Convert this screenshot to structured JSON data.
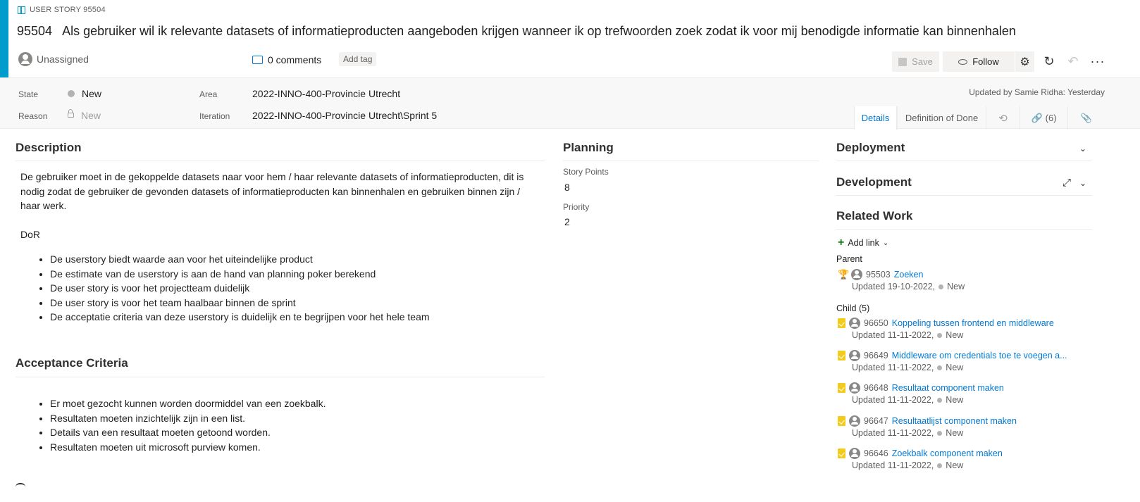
{
  "header": {
    "type_label": "USER STORY 95504",
    "id": "95504",
    "title": "Als gebruiker wil ik relevante datasets of informatieproducten aangeboden krijgen wanneer ik op trefwoorden zoek zodat ik voor mij benodigde informatie kan binnenhalen",
    "assignee": "Unassigned",
    "comments": "0 comments",
    "add_tag": "Add tag",
    "accent_color": "#009ccc"
  },
  "toolbar": {
    "save": "Save",
    "follow": "Follow",
    "settings_icon": "gear-icon",
    "refresh_icon": "refresh-icon",
    "undo_icon": "undo-icon",
    "more_icon": "more-icon"
  },
  "fields": {
    "state_label": "State",
    "state_value": "New",
    "reason_label": "Reason",
    "reason_value": "New",
    "area_label": "Area",
    "area_value": "2022-INNO-400-Provincie Utrecht",
    "iteration_label": "Iteration",
    "iteration_value": "2022-INNO-400-Provincie Utrecht\\Sprint 5",
    "updated_by": "Updated by Samie Ridha: Yesterday"
  },
  "tabs": {
    "details": "Details",
    "dod": "Definition of Done",
    "history_icon": "history-icon",
    "links": "(6)",
    "attachment_icon": "paperclip-icon"
  },
  "description": {
    "title": "Description",
    "paragraph": "De gebruiker moet in de gekoppelde datasets naar voor hem / haar relevante datasets of informatieproducten, dit is nodig zodat de gebruiker de gevonden datasets of informatieproducten kan binnenhalen en gebruiken binnen zijn / haar werk.",
    "dor": "DoR",
    "bullets": [
      "De userstory biedt waarde aan voor het uiteindelijke product",
      "De estimate van de userstory is aan de hand van planning poker berekend",
      "De user story is voor het projectteam duidelijk",
      "De user story is voor het team haalbaar binnen de sprint",
      "De acceptatie criteria van deze userstory is duidelijk en te begrijpen voor het hele team"
    ]
  },
  "acceptance": {
    "title": "Acceptance Criteria",
    "bullets": [
      "Er moet gezocht kunnen worden doormiddel van een zoekbalk.",
      "Resultaten moeten inzichtelijk zijn in een list.",
      "Details van een resultaat moeten getoond worden.",
      "Resultaten moeten uit microsoft purview komen."
    ]
  },
  "planning": {
    "title": "Planning",
    "story_points_label": "Story Points",
    "story_points": "8",
    "priority_label": "Priority",
    "priority": "2"
  },
  "deployment": {
    "title": "Deployment"
  },
  "development": {
    "title": "Development"
  },
  "related": {
    "title": "Related Work",
    "add_link": "Add link",
    "parent_label": "Parent",
    "parent": {
      "id": "95503",
      "title": "Zoeken",
      "updated": "Updated 19-10-2022,",
      "state": "New"
    },
    "child_label": "Child (5)",
    "children": [
      {
        "id": "96650",
        "title": "Koppeling tussen frontend en middleware",
        "updated": "Updated 11-11-2022,",
        "state": "New"
      },
      {
        "id": "96649",
        "title": "Middleware om credentials toe te voegen a...",
        "updated": "Updated 11-11-2022,",
        "state": "New"
      },
      {
        "id": "96648",
        "title": "Resultaat component maken",
        "updated": "Updated 11-11-2022,",
        "state": "New"
      },
      {
        "id": "96647",
        "title": "Resultaatlijst component maken",
        "updated": "Updated 11-11-2022,",
        "state": "New"
      },
      {
        "id": "96646",
        "title": "Zoekbalk component maken",
        "updated": "Updated 11-11-2022,",
        "state": "New"
      }
    ]
  }
}
